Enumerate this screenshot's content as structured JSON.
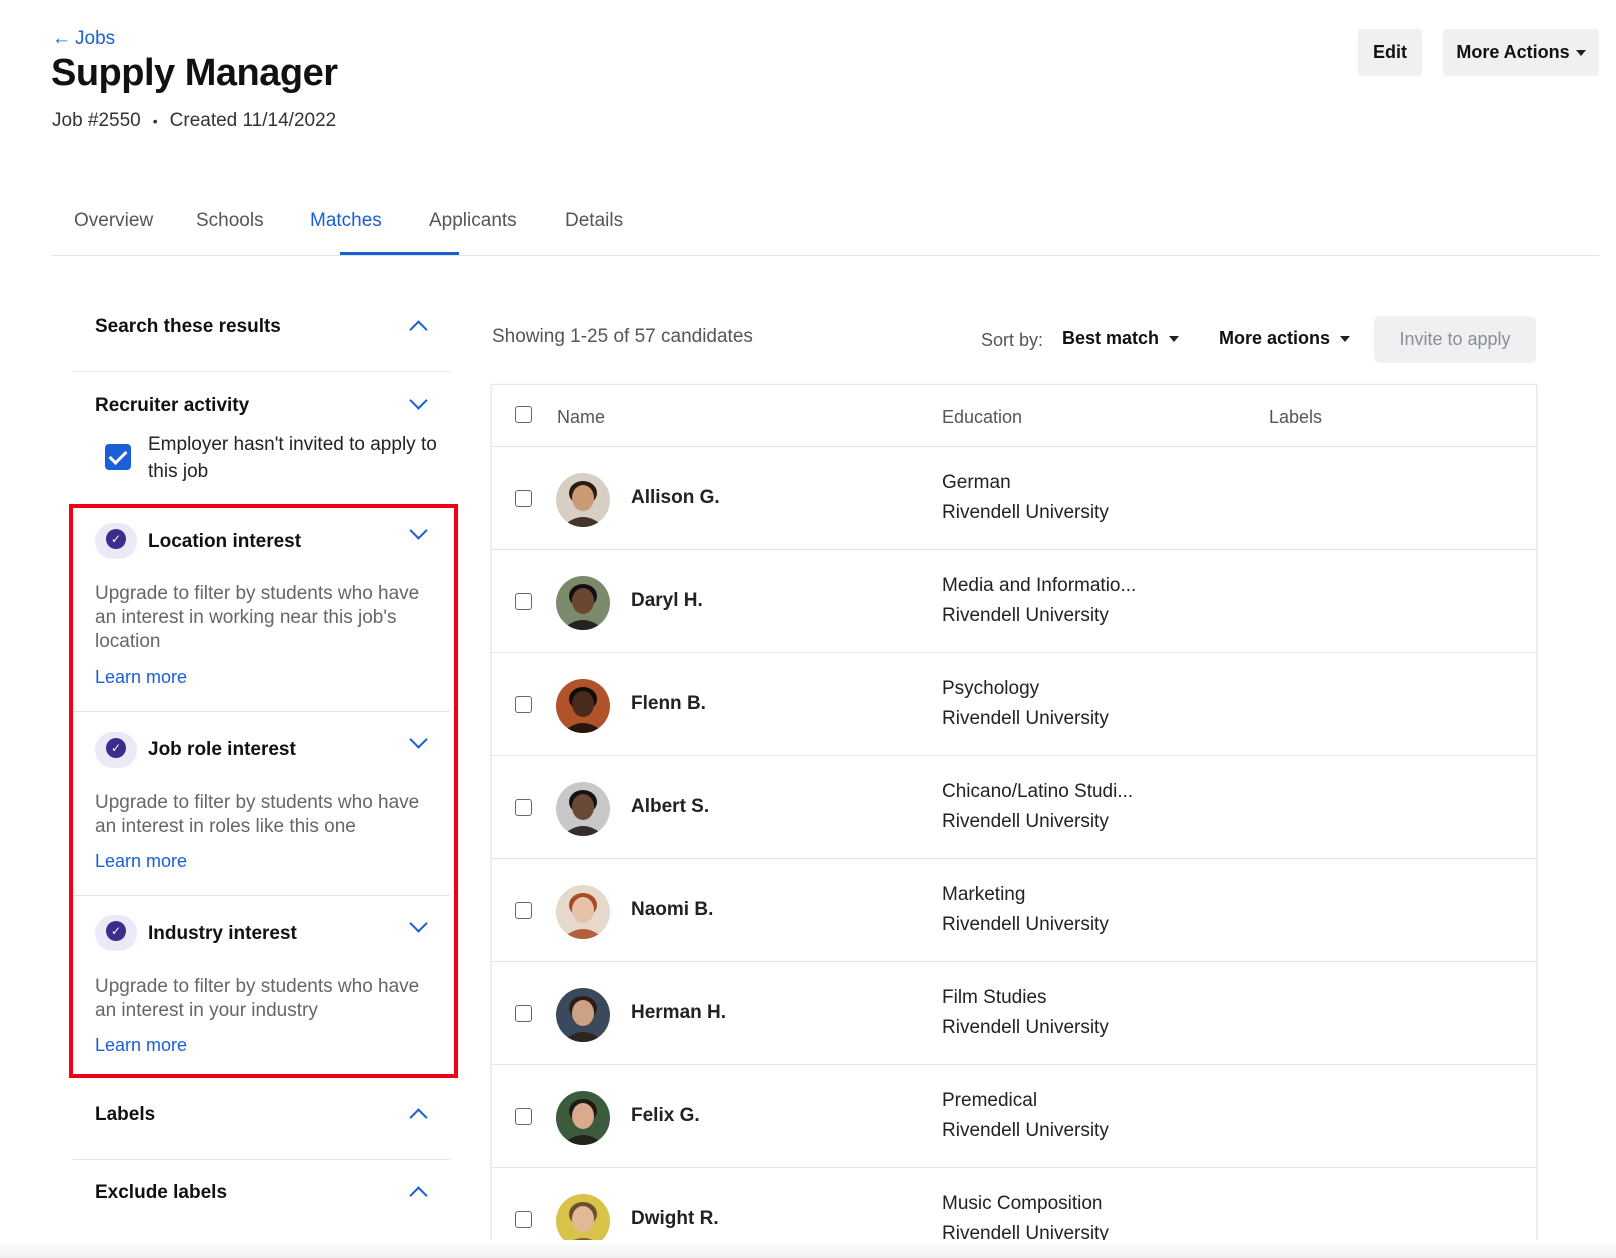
{
  "header": {
    "back_label": "Jobs",
    "title": "Supply Manager",
    "job_number": "Job #2550",
    "created": "Created 11/14/2022",
    "edit_label": "Edit",
    "more_actions_label": "More Actions"
  },
  "tabs": [
    {
      "label": "Overview",
      "active": false
    },
    {
      "label": "Schools",
      "active": false
    },
    {
      "label": "Matches",
      "active": true
    },
    {
      "label": "Applicants",
      "active": false
    },
    {
      "label": "Details",
      "active": false
    }
  ],
  "filters": {
    "search_results": "Search these results",
    "recruiter_activity": "Recruiter activity",
    "employer_checkbox_label": "Employer hasn't invited to apply to this job",
    "premium": [
      {
        "title": "Location interest",
        "desc": "Upgrade to filter by students who have an interest in working near this job's location",
        "link": "Learn more"
      },
      {
        "title": "Job role interest",
        "desc": "Upgrade to filter by students who have an interest in roles like this one",
        "link": "Learn more"
      },
      {
        "title": "Industry interest",
        "desc": "Upgrade to filter by students who have an interest in your industry",
        "link": "Learn more"
      }
    ],
    "labels": "Labels",
    "exclude_labels": "Exclude labels"
  },
  "results": {
    "showing": "Showing 1-25 of 57 candidates",
    "sort_label": "Sort by:",
    "sort_value": "Best match",
    "more_actions": "More actions",
    "invite_label": "Invite to apply",
    "columns": {
      "name": "Name",
      "education": "Education",
      "labels": "Labels"
    },
    "candidates": [
      {
        "name": "Allison G.",
        "major": "German",
        "school": "Rivendell University",
        "skin": "#c99a74",
        "hair": "#2a1a10",
        "bg": "#d8cfc4"
      },
      {
        "name": "Daryl H.",
        "major": "Media and Informatio...",
        "school": "Rivendell University",
        "skin": "#6b4630",
        "hair": "#151010",
        "bg": "#7c8a6c"
      },
      {
        "name": "Flenn B.",
        "major": "Psychology",
        "school": "Rivendell University",
        "skin": "#4a2a1c",
        "hair": "#120c08",
        "bg": "#b0522a"
      },
      {
        "name": "Albert S.",
        "major": "Chicano/Latino Studi...",
        "school": "Rivendell University",
        "skin": "#6a4a36",
        "hair": "#1a1210",
        "bg": "#c8c8c8"
      },
      {
        "name": "Naomi B.",
        "major": "Marketing",
        "school": "Rivendell University",
        "skin": "#e7c2a8",
        "hair": "#a84a22",
        "bg": "#e6d9cb"
      },
      {
        "name": "Herman H.",
        "major": "Film Studies",
        "school": "Rivendell University",
        "skin": "#cfa184",
        "hair": "#2b1e16",
        "bg": "#3a4a5c"
      },
      {
        "name": "Felix G.",
        "major": "Premedical",
        "school": "Rivendell University",
        "skin": "#d9aa8c",
        "hair": "#1e1a14",
        "bg": "#3c5a3c"
      },
      {
        "name": "Dwight R.",
        "major": "Music Composition",
        "school": "Rivendell University",
        "skin": "#e3b995",
        "hair": "#6a5030",
        "bg": "#d8c24a"
      }
    ]
  },
  "colors": {
    "accent": "#1a5fd6",
    "highlight_border": "#f00017",
    "badge": "#3a2d8c"
  }
}
